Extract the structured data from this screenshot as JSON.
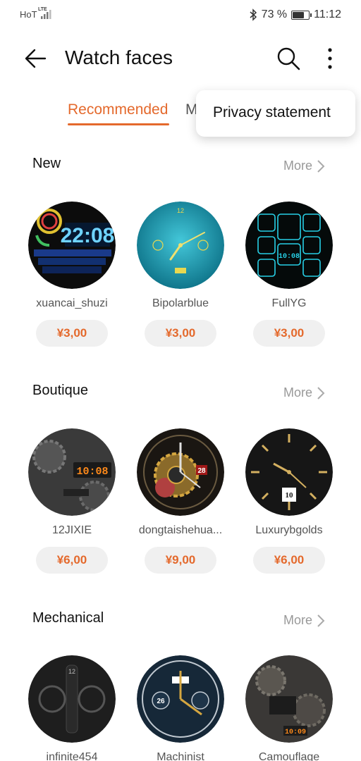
{
  "status_bar": {
    "carrier": "HoT",
    "network": "LTE",
    "battery_percent": "73 %",
    "battery_level": 0.73,
    "time": "11:12"
  },
  "header": {
    "title": "Watch faces",
    "back_icon": "back-arrow-icon",
    "search_icon": "search-icon",
    "menu_icon": "more-vert-icon"
  },
  "tabs": {
    "active_label": "Recommended",
    "other_label": "M"
  },
  "popup_menu": {
    "items": [
      "Privacy statement"
    ]
  },
  "colors": {
    "accent": "#E4692C",
    "price_bg": "#f0f0f0",
    "muted_text": "#999999"
  },
  "sections": [
    {
      "title": "New",
      "more_label": "More",
      "items": [
        {
          "name": "xuancai_shuzi",
          "price": "¥3,00",
          "face_text": "22:08"
        },
        {
          "name": "Bipolarblue",
          "price": "¥3,00",
          "face_text": "12"
        },
        {
          "name": "FullYG",
          "price": "¥3,00",
          "face_text": "10:08"
        }
      ]
    },
    {
      "title": "Boutique",
      "more_label": "More",
      "items": [
        {
          "name": "12JIXIE",
          "price": "¥6,00",
          "face_text": "10:08"
        },
        {
          "name": "dongtaishehua...",
          "price": "¥9,00",
          "face_text": "28"
        },
        {
          "name": "Luxurybgolds",
          "price": "¥6,00",
          "face_text": "10"
        }
      ]
    },
    {
      "title": "Mechanical",
      "more_label": "More",
      "items": [
        {
          "name": "infinite454",
          "price": "",
          "face_text": "12"
        },
        {
          "name": "Machinist",
          "price": "",
          "face_text": "26"
        },
        {
          "name": "Camouflage",
          "price": "",
          "face_text": "10:09"
        }
      ]
    }
  ]
}
